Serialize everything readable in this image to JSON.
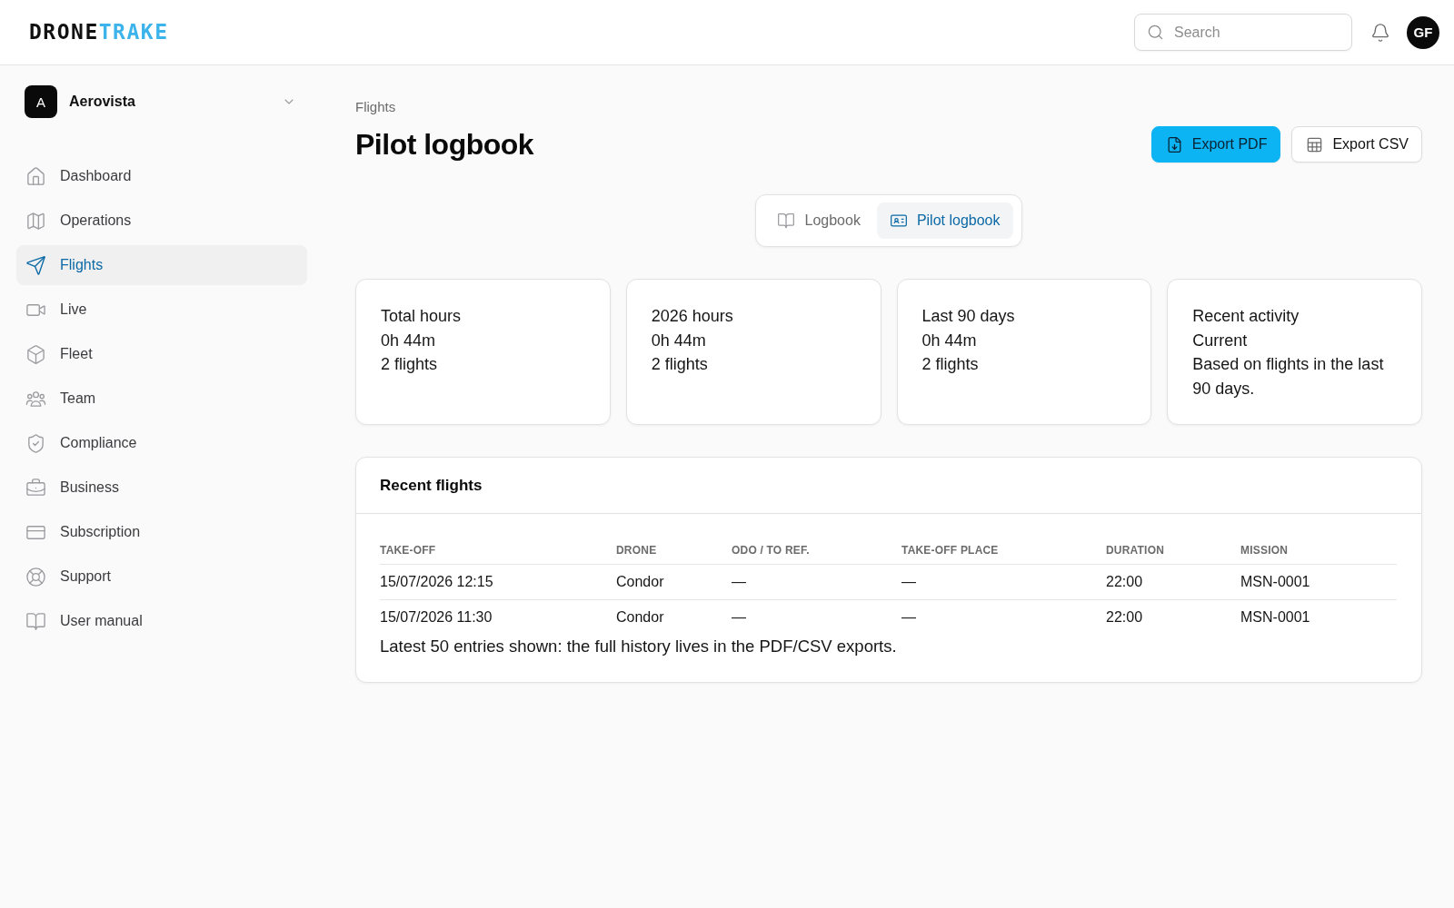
{
  "header": {
    "logo": {
      "primary": "DRONE",
      "accent": "TRAKE"
    },
    "search": {
      "placeholder": "Search"
    },
    "avatar": {
      "initials": "GF"
    }
  },
  "sidebar": {
    "workspace": {
      "initial": "A",
      "name": "Aerovista"
    },
    "items": [
      {
        "label": "Dashboard",
        "selected": false
      },
      {
        "label": "Operations",
        "selected": false
      },
      {
        "label": "Flights",
        "selected": true
      },
      {
        "label": "Live",
        "selected": false
      },
      {
        "label": "Fleet",
        "selected": false
      },
      {
        "label": "Team",
        "selected": false
      },
      {
        "label": "Compliance",
        "selected": false
      },
      {
        "label": "Business",
        "selected": false
      },
      {
        "label": "Subscription",
        "selected": false
      },
      {
        "label": "Support",
        "selected": false
      },
      {
        "label": "User manual",
        "selected": false
      }
    ]
  },
  "page": {
    "breadcrumb": "Flights",
    "title": "Pilot logbook",
    "actions": [
      {
        "label": "Export PDF",
        "kind": "primary"
      },
      {
        "label": "Export CSV",
        "kind": "secondary"
      }
    ]
  },
  "view_tabs": [
    {
      "label": "Logbook",
      "selected": false
    },
    {
      "label": "Pilot logbook",
      "selected": true
    }
  ],
  "stats": [
    {
      "label": "Total hours",
      "value": "0h 44m",
      "detail": "2 flights"
    },
    {
      "label": "2026 hours",
      "value": "0h 44m",
      "detail": "2 flights"
    },
    {
      "label": "Last 90 days",
      "value": "0h 44m",
      "detail": "2 flights"
    },
    {
      "label": "Recent activity",
      "value": "Current",
      "detail": "Based on flights in the last 90 days."
    }
  ],
  "recent_flights": {
    "title": "Recent flights",
    "columns": [
      "TAKE-OFF",
      "DRONE",
      "ODO / TO REF.",
      "TAKE-OFF PLACE",
      "DURATION",
      "MISSION"
    ],
    "rows": [
      [
        "15/07/2026 12:15",
        "Condor",
        "—",
        "—",
        "22:00",
        "MSN-0001"
      ],
      [
        "15/07/2026 11:30",
        "Condor",
        "—",
        "—",
        "22:00",
        "MSN-0001"
      ]
    ],
    "note": "Latest 50 entries shown: the full history lives in the PDF/CSV exports."
  }
}
